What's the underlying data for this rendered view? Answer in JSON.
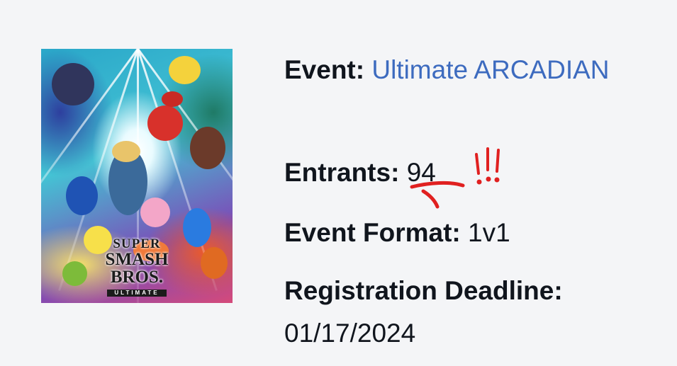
{
  "cover": {
    "logo_line1": "SUPER",
    "logo_line2": "SMASH BROS.",
    "logo_line3": "ULTIMATE"
  },
  "event": {
    "label": "Event:",
    "name": "Ultimate ARCADIAN"
  },
  "entrants": {
    "label": "Entrants:",
    "count": "94"
  },
  "format": {
    "label": "Event Format:",
    "value": "1v1"
  },
  "registration": {
    "label": "Registration Deadline:",
    "deadline": "01/17/2024"
  },
  "annotation": {
    "color": "#e02020"
  }
}
